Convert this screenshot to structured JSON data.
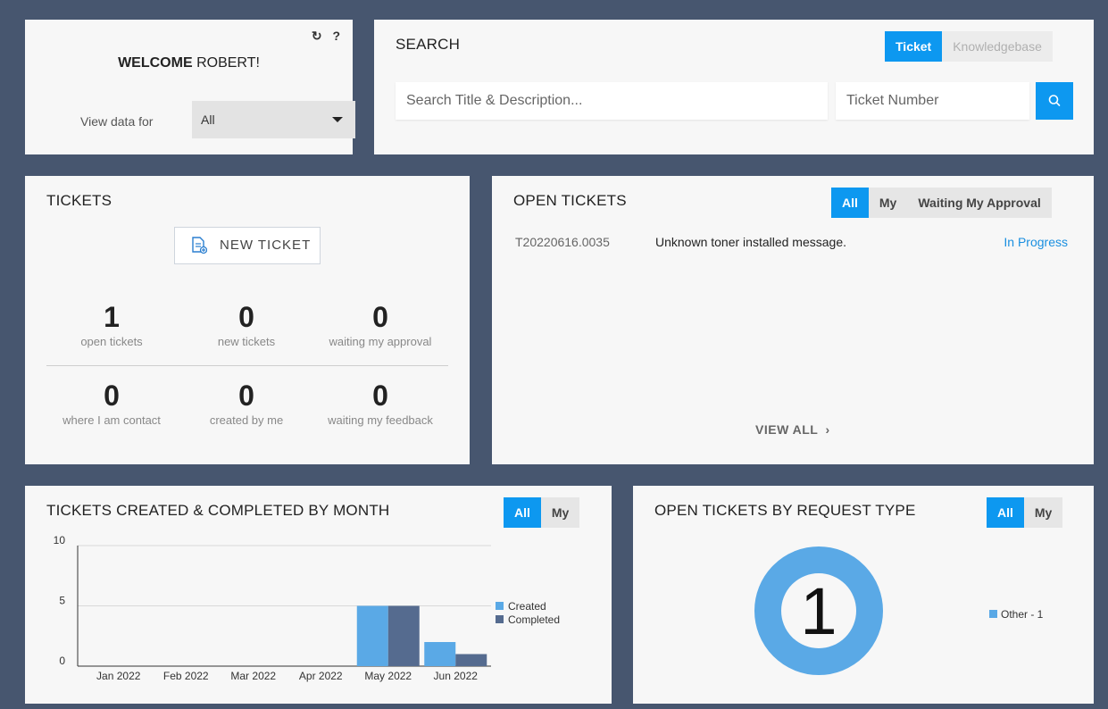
{
  "welcome": {
    "greeting_bold": "WELCOME",
    "greeting_name": "ROBERT!",
    "refresh_icon": "↻",
    "help_icon": "?",
    "view_label": "View data for",
    "view_value": "All"
  },
  "search": {
    "title": "SEARCH",
    "tabs": [
      {
        "label": "Ticket",
        "active": true
      },
      {
        "label": "Knowledgebase",
        "active": false
      }
    ],
    "title_placeholder": "Search Title & Description...",
    "number_placeholder": "Ticket Number"
  },
  "tickets": {
    "title": "TICKETS",
    "new_ticket_label": "NEW TICKET",
    "stats": [
      {
        "value": "1",
        "label": "open tickets"
      },
      {
        "value": "0",
        "label": "new tickets"
      },
      {
        "value": "0",
        "label": "waiting my approval"
      },
      {
        "value": "0",
        "label": "where I am contact"
      },
      {
        "value": "0",
        "label": "created by me"
      },
      {
        "value": "0",
        "label": "waiting my feedback"
      }
    ]
  },
  "open_tickets": {
    "title": "OPEN TICKETS",
    "filters": [
      {
        "label": "All",
        "active": true
      },
      {
        "label": "My",
        "active": false
      },
      {
        "label": "Waiting My Approval",
        "active": false
      }
    ],
    "rows": [
      {
        "number": "T20220616.0035",
        "title": "Unknown toner installed message.",
        "status": "In Progress"
      }
    ],
    "view_all": "VIEW ALL",
    "status_color": "#1a8fe0"
  },
  "monthly": {
    "title": "TICKETS CREATED & COMPLETED BY MONTH",
    "filters": [
      {
        "label": "All",
        "active": true
      },
      {
        "label": "My",
        "active": false
      }
    ]
  },
  "by_type": {
    "title": "OPEN TICKETS BY REQUEST TYPE",
    "filters": [
      {
        "label": "All",
        "active": true
      },
      {
        "label": "My",
        "active": false
      }
    ]
  },
  "chart_data": [
    {
      "type": "bar",
      "categories": [
        "Jan 2022",
        "Feb 2022",
        "Mar 2022",
        "Apr 2022",
        "May 2022",
        "Jun 2022"
      ],
      "series": [
        {
          "name": "Created",
          "values": [
            0,
            0,
            0,
            0,
            5,
            2
          ],
          "color": "#5aa9e6"
        },
        {
          "name": "Completed",
          "values": [
            0,
            0,
            0,
            0,
            5,
            1
          ],
          "color": "#556b8f"
        }
      ],
      "yticks": [
        0,
        5,
        10
      ],
      "ylim": [
        0,
        10
      ],
      "legend": "right"
    },
    {
      "type": "pie",
      "labels": [
        "Other - 1"
      ],
      "values": [
        1
      ],
      "colors": [
        "#5aa9e6"
      ],
      "center_label": "1",
      "legend": "right"
    }
  ],
  "colors": {
    "accent": "#0d98f0",
    "background": "#47566f",
    "card": "#f7f7f7"
  }
}
